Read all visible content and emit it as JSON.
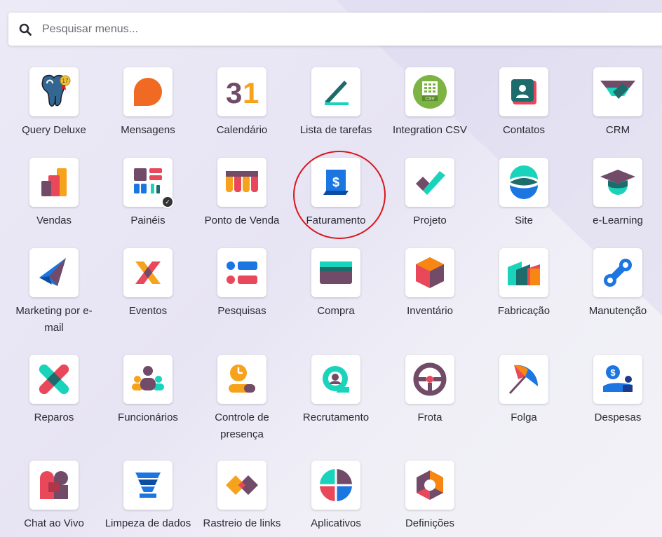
{
  "search": {
    "placeholder": "Pesquisar menus..."
  },
  "apps": [
    {
      "label": "Query Deluxe",
      "icon": "query-deluxe-icon"
    },
    {
      "label": "Mensagens",
      "icon": "mensagens-icon"
    },
    {
      "label": "Calendário",
      "icon": "calendario-icon",
      "icon_text": "31"
    },
    {
      "label": "Lista de tarefas",
      "icon": "lista-de-tarefas-icon"
    },
    {
      "label": "Integration CSV",
      "icon": "integration-csv-icon",
      "icon_text": "CSV"
    },
    {
      "label": "Contatos",
      "icon": "contatos-icon"
    },
    {
      "label": "CRM",
      "icon": "crm-icon"
    },
    {
      "label": "Vendas",
      "icon": "vendas-icon"
    },
    {
      "label": "Painéis",
      "icon": "paineis-icon"
    },
    {
      "label": "Ponto de Venda",
      "icon": "ponto-de-venda-icon"
    },
    {
      "label": "Faturamento",
      "icon": "faturamento-icon",
      "icon_text": "$"
    },
    {
      "label": "Projeto",
      "icon": "projeto-icon"
    },
    {
      "label": "Site",
      "icon": "site-icon"
    },
    {
      "label": "e-Learning",
      "icon": "e-learning-icon"
    },
    {
      "label": "Marketing por e-mail",
      "icon": "marketing-email-icon"
    },
    {
      "label": "Eventos",
      "icon": "eventos-icon"
    },
    {
      "label": "Pesquisas",
      "icon": "pesquisas-icon"
    },
    {
      "label": "Compra",
      "icon": "compra-icon"
    },
    {
      "label": "Inventário",
      "icon": "inventario-icon"
    },
    {
      "label": "Fabricação",
      "icon": "fabricacao-icon"
    },
    {
      "label": "Manutenção",
      "icon": "manutencao-icon"
    },
    {
      "label": "Reparos",
      "icon": "reparos-icon"
    },
    {
      "label": "Funcionários",
      "icon": "funcionarios-icon"
    },
    {
      "label": "Controle de presença",
      "icon": "controle-presenca-icon"
    },
    {
      "label": "Recrutamento",
      "icon": "recrutamento-icon"
    },
    {
      "label": "Frota",
      "icon": "frota-icon"
    },
    {
      "label": "Folga",
      "icon": "folga-icon"
    },
    {
      "label": "Despesas",
      "icon": "despesas-icon",
      "icon_text": "$"
    },
    {
      "label": "Chat ao Vivo",
      "icon": "chat-ao-vivo-icon"
    },
    {
      "label": "Limpeza de dados",
      "icon": "limpeza-dados-icon"
    },
    {
      "label": "Rastreio de links",
      "icon": "rastreio-links-icon"
    },
    {
      "label": "Aplicativos",
      "icon": "aplicativos-icon"
    },
    {
      "label": "Definições",
      "icon": "definicoes-icon"
    }
  ],
  "colors": {
    "purple": "#714b67",
    "teal": "#1ad3bb",
    "orange": "#f78613",
    "red": "#ea5154",
    "blue": "#1b76e2",
    "highlight": "#d8161b"
  }
}
